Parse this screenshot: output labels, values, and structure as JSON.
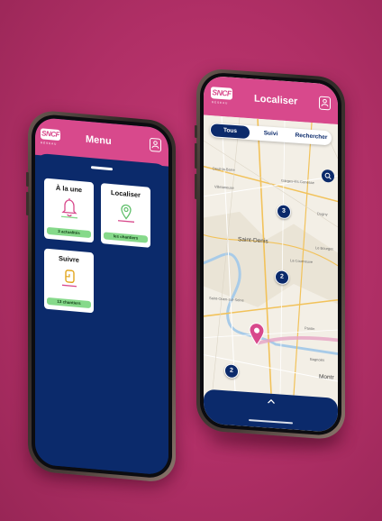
{
  "colors": {
    "brand_pink": "#d8498c",
    "navy": "#0b2a6b",
    "badge_green": "#86d98a",
    "backdrop": "#b8326b"
  },
  "left_phone": {
    "logo": "SNCF",
    "logo_sub": "RÉSEAU",
    "title": "Menu",
    "profile_icon": "user-profile-icon",
    "tiles": [
      {
        "title": "À la une",
        "icon": "bell-icon",
        "badge": "3 actualités"
      },
      {
        "title": "Localiser",
        "icon": "map-pin-icon",
        "badge": "les chantiers"
      },
      {
        "title": "Suivre",
        "icon": "tracked-work-icon",
        "badge": "13 chantiers"
      }
    ]
  },
  "right_phone": {
    "logo": "SNCF",
    "logo_sub": "RÉSEAU",
    "title": "Localiser",
    "profile_icon": "user-profile-icon",
    "tabs": [
      {
        "label": "Tous",
        "active": true
      },
      {
        "label": "Suivi",
        "active": false
      },
      {
        "label": "Rechercher",
        "active": false
      }
    ],
    "filter_icon": "filter-icon",
    "clusters": [
      "3",
      "2",
      "2"
    ],
    "places": {
      "saint_denis": "Saint-Denis",
      "deuil": "Deuil-la-Barre",
      "villetaneuse": "Villetaneuse",
      "sarcelles": "Garges-lès-Gonesse",
      "dugny": "Dugny",
      "le_bourget": "Le Bourget",
      "la_courneuve": "La Courneuve",
      "saint_ouen": "Saint-Ouen-sur-Seine",
      "pantin": "Pantin",
      "bagnolet": "Bagnolet",
      "montreuil": "Montr"
    },
    "collapse_icon": "chevron-up-icon"
  }
}
